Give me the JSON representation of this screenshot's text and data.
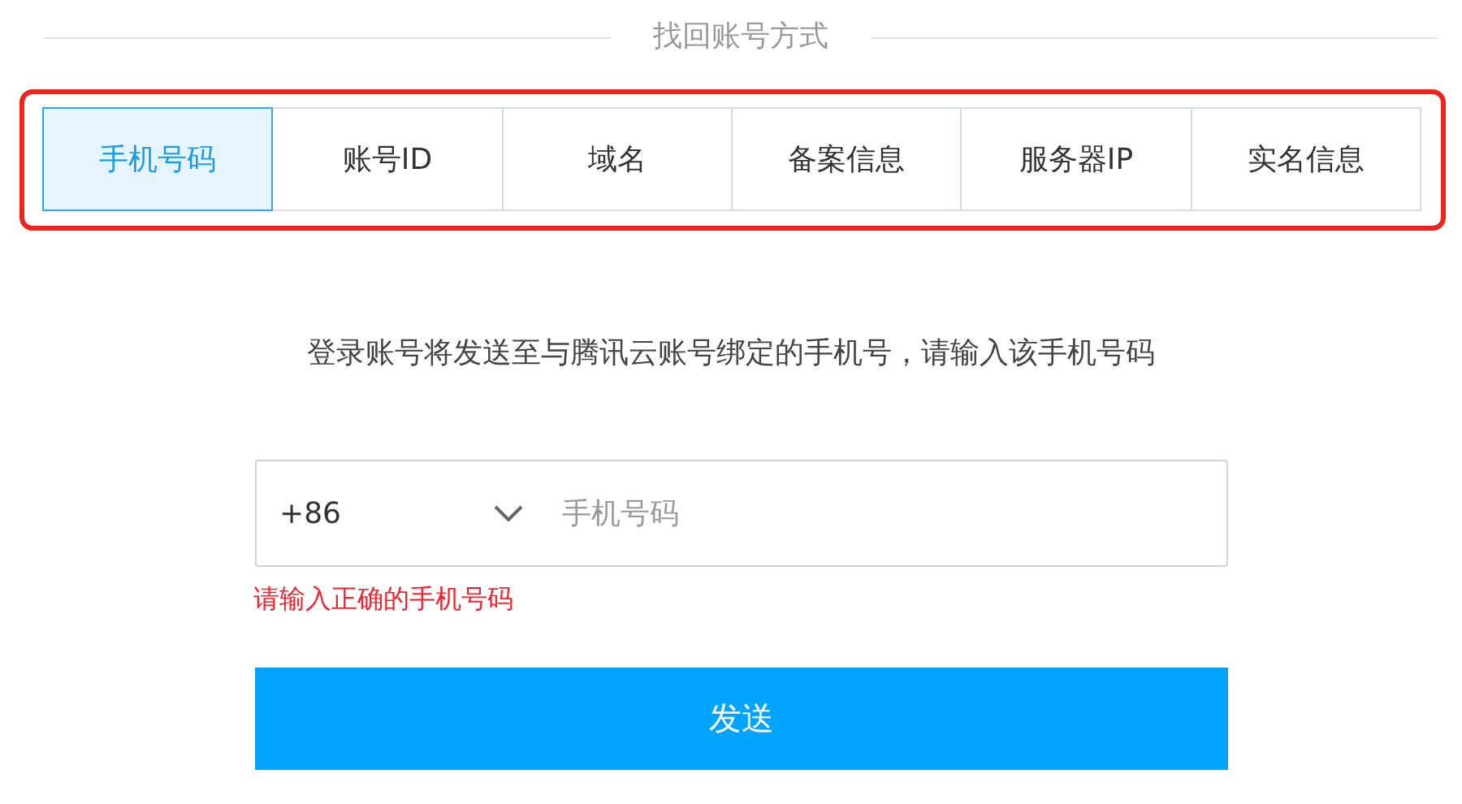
{
  "heading": "找回账号方式",
  "tabs": [
    {
      "label": "手机号码",
      "selected": true
    },
    {
      "label": "账号ID",
      "selected": false
    },
    {
      "label": "域名",
      "selected": false
    },
    {
      "label": "备案信息",
      "selected": false
    },
    {
      "label": "服务器IP",
      "selected": false
    },
    {
      "label": "实名信息",
      "selected": false
    }
  ],
  "instruction": "登录账号将发送至与腾讯云账号绑定的手机号，请输入该手机号码",
  "phone": {
    "country_code": "+86",
    "placeholder": "手机号码",
    "error": "请输入正确的手机号码"
  },
  "submit": "发送"
}
